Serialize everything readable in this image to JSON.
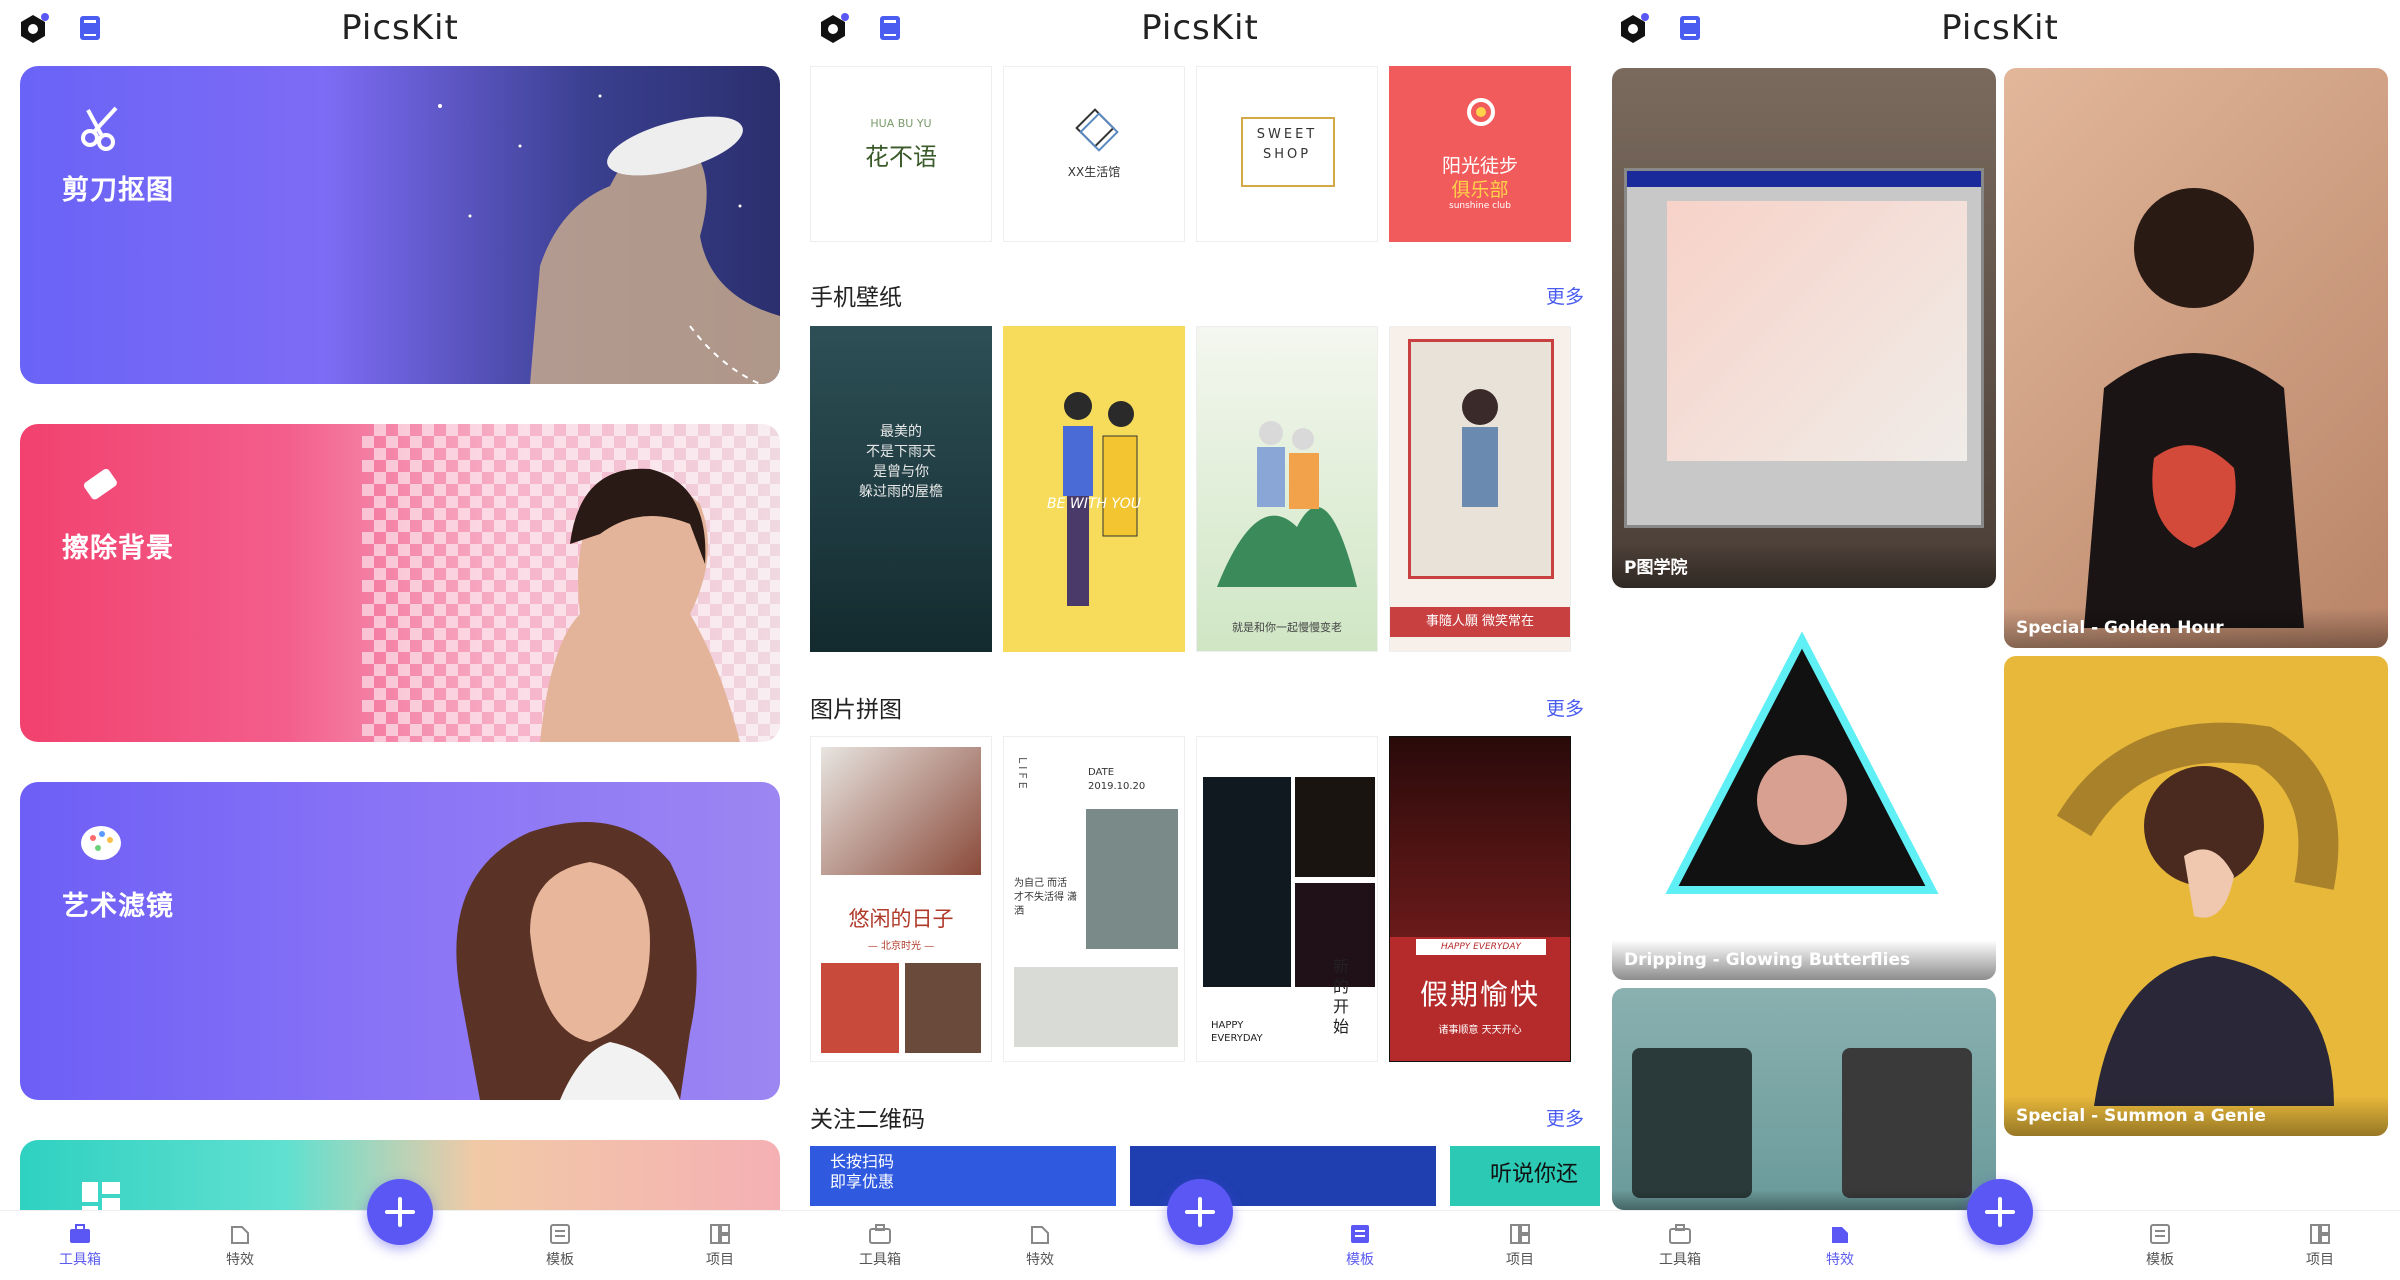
{
  "app_title": "PicsKit",
  "tabs": [
    "工具箱",
    "特效",
    "模板",
    "项目"
  ],
  "screen1": {
    "active_tab": "工具箱",
    "cards": [
      {
        "label": "剪刀抠图",
        "icon": "scissors-icon"
      },
      {
        "label": "擦除背景",
        "icon": "eraser-icon"
      },
      {
        "label": "艺术滤镜",
        "icon": "palette-icon"
      },
      {
        "label": "",
        "icon": "grid-icon"
      }
    ]
  },
  "screen2": {
    "active_tab": "模板",
    "logos": [
      {
        "line1": "HUA  BU  YU",
        "line2": "花不语"
      },
      {
        "line1": "XX生活馆",
        "line2": ""
      },
      {
        "line1": "SWEET",
        "line2": "SHOP"
      },
      {
        "line1": "阳光徒步",
        "line2": "俱乐部",
        "line3": "sunshine club"
      }
    ],
    "sections": [
      {
        "title": "手机壁纸",
        "more": "更多"
      },
      {
        "title": "图片拼图",
        "more": "更多"
      },
      {
        "title": "关注二维码",
        "more": "更多"
      }
    ],
    "wallpapers": [
      {
        "text1": "最美的",
        "text2": "不是下雨天",
        "text3": "是曾与你",
        "text4": "躲过雨的屋檐"
      },
      {
        "text1": "BE WITH YOU"
      },
      {
        "text1": "就是和你一起慢慢变老"
      },
      {
        "text1": "事隨人願  微笑常在"
      }
    ],
    "collages": [
      {
        "title": "悠闲的日子",
        "sub": "— 北京时光 —"
      },
      {
        "date": "DATE",
        "date2": "2019.10.20",
        "vert": "LIFE",
        "text": "为自己 而活 才不失活得 潇洒"
      },
      {
        "text1": "HAPPY",
        "text2": "EVERYDAY",
        "text3": "新的开始"
      },
      {
        "tag": "HAPPY EVERYDAY",
        "title": "假期愉快",
        "sub": "诸事顺意 天天开心"
      }
    ],
    "qr": [
      {
        "text1": "长按扫码",
        "text2": "即享优惠"
      },
      {
        "text1": ""
      },
      {
        "text1": "听说你还"
      }
    ]
  },
  "screen3": {
    "active_tab": "特效",
    "items": [
      {
        "label": "P图学院"
      },
      {
        "label": "Special - Golden Hour"
      },
      {
        "label": "Dripping - Glowing Butterflies"
      },
      {
        "label": "Special - Summon a Genie"
      },
      {
        "label": ""
      }
    ]
  },
  "colors": {
    "accent": "#5b57f5",
    "more_link": "#4a5cf0"
  }
}
